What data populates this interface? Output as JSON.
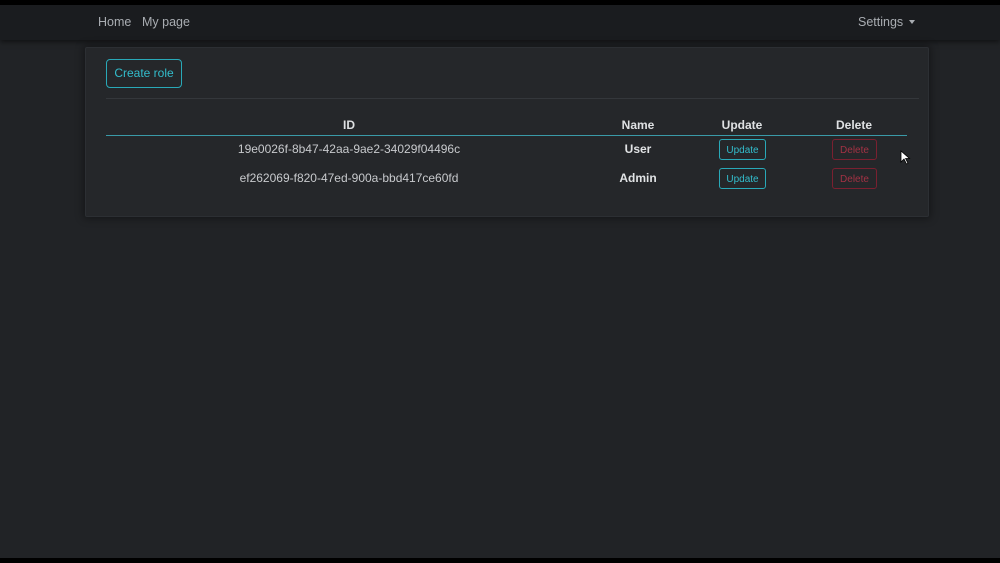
{
  "navbar": {
    "home": "Home",
    "my_page": "My page",
    "settings": "Settings"
  },
  "card": {
    "create_role": "Create role"
  },
  "table": {
    "headers": [
      "ID",
      "Name",
      "Update",
      "Delete"
    ],
    "rows": [
      {
        "id": "19e0026f-8b47-42aa-9ae2-34029f04496c",
        "name": "User",
        "update": "Update",
        "delete": "Delete"
      },
      {
        "id": "ef262069-f820-47ed-900a-bbd417ce60fd",
        "name": "Admin",
        "update": "Update",
        "delete": "Delete"
      }
    ]
  },
  "colors": {
    "background": "#212326",
    "navbar": "#1a1c1f",
    "accent": "#33bdcc",
    "danger": "#a33244"
  }
}
